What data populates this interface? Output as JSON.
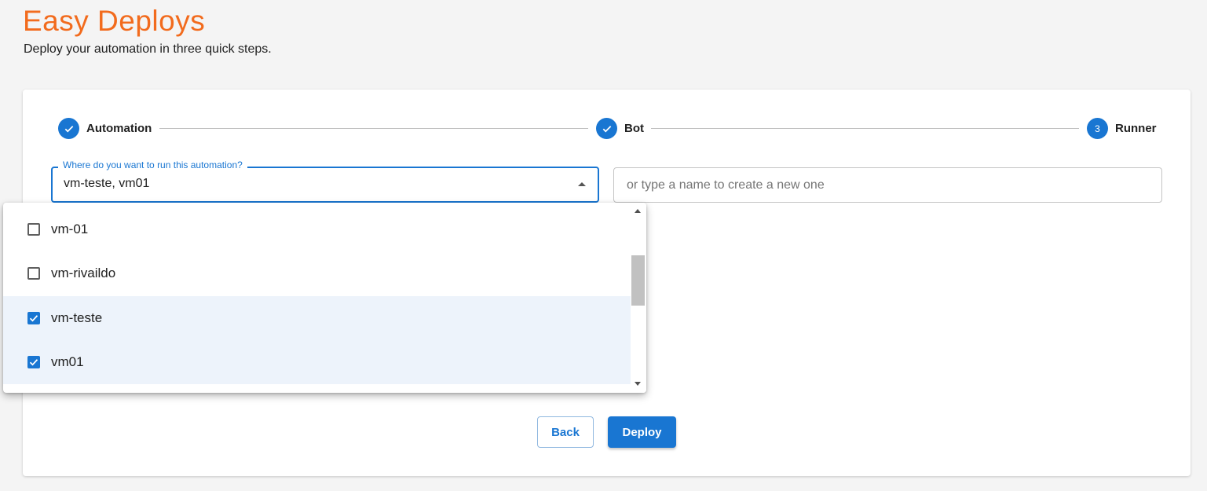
{
  "header": {
    "title": "Easy Deploys",
    "subtitle": "Deploy your automation in three quick steps."
  },
  "stepper": {
    "steps": [
      {
        "label": "Automation",
        "state": "completed"
      },
      {
        "label": "Bot",
        "state": "completed"
      },
      {
        "label": "Runner",
        "state": "active",
        "number": "3"
      }
    ]
  },
  "form": {
    "runner_select": {
      "label": "Where do you want to run this automation?",
      "value": "vm-teste, vm01",
      "options": [
        {
          "label": "vm-01",
          "checked": false
        },
        {
          "label": "vm-rivaildo",
          "checked": false
        },
        {
          "label": "vm-teste",
          "checked": true
        },
        {
          "label": "vm01",
          "checked": true
        }
      ]
    },
    "new_runner_input": {
      "placeholder": "or type a name to create a new one",
      "value": ""
    }
  },
  "actions": {
    "back_label": "Back",
    "deploy_label": "Deploy"
  },
  "colors": {
    "brand_orange": "#f26b1d",
    "primary_blue": "#1976d2",
    "selected_row": "#edf3fb"
  }
}
